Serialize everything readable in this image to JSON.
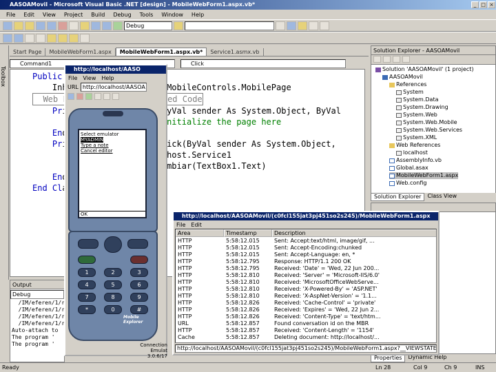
{
  "window": {
    "title": "AASOAMovil - Microsoft Visual Basic .NET [design] - MobileWebForm1.aspx.vb*"
  },
  "menu": [
    "File",
    "Edit",
    "View",
    "Project",
    "Build",
    "Debug",
    "Tools",
    "Window",
    "Help"
  ],
  "toolbar": {
    "config": "Debug",
    "find": ""
  },
  "doc_tabs": [
    {
      "label": "Start Page",
      "active": false
    },
    {
      "label": "MobileWebForm1.aspx",
      "active": false
    },
    {
      "label": "MobileWebForm1.aspx.vb*",
      "active": true
    },
    {
      "label": "Service1.asmx.vb",
      "active": false
    }
  ],
  "toolbox_label": "Toolbox",
  "editor": {
    "class_combo": "Command1",
    "method_combo": "Click",
    "lines": [
      {
        "kw": "Public Cl",
        "rest": ""
      },
      {
        "kw": "",
        "rest": "    Inherits System.Web.UI.MobileControls.MobilePage"
      },
      {
        "kw": "",
        "rest": "  Web Form Designer Generated Code"
      },
      {
        "kw": "",
        "rest": ""
      },
      {
        "kw": "    Pr",
        "rest": "ivate Sub Page_Load(ByVal sender As System.Object, ByVal"
      },
      {
        "kw": "",
        "rest": "        'Put user code to initialize the page here"
      },
      {
        "kw": "    En",
        "rest": "d Sub"
      },
      {
        "kw": "",
        "rest": ""
      },
      {
        "kw": "    Pr",
        "rest": "ivate Sub Command1_Click(ByVal sender As System.Object,"
      },
      {
        "kw": "",
        "rest": "        Dim ws As New localhost.Service1"
      },
      {
        "kw": "",
        "rest": "        Label1.Text = ws.Cambiar(TextBox1.Text)"
      },
      {
        "kw": "    En",
        "rest": "d Sub"
      },
      {
        "kw": "End Cl",
        "rest": "ass"
      }
    ]
  },
  "solution": {
    "header": "Solution Explorer - AASOAMovil",
    "items": [
      {
        "label": "Solution 'AASOAMovil' (1 project)",
        "icon": "sln",
        "indent": 0
      },
      {
        "label": "AASOAMovil",
        "icon": "proj",
        "indent": 1
      },
      {
        "label": "References",
        "icon": "fld",
        "indent": 2
      },
      {
        "label": "System",
        "icon": "ref",
        "indent": 3
      },
      {
        "label": "System.Data",
        "icon": "ref",
        "indent": 3
      },
      {
        "label": "System.Drawing",
        "icon": "ref",
        "indent": 3
      },
      {
        "label": "System.Web",
        "icon": "ref",
        "indent": 3
      },
      {
        "label": "System.Web.Mobile",
        "icon": "ref",
        "indent": 3
      },
      {
        "label": "System.Web.Services",
        "icon": "ref",
        "indent": 3
      },
      {
        "label": "System.XML",
        "icon": "ref",
        "indent": 3
      },
      {
        "label": "Web References",
        "icon": "fld",
        "indent": 2
      },
      {
        "label": "localhost",
        "icon": "ref",
        "indent": 3
      },
      {
        "label": "AssemblyInfo.vb",
        "icon": "file",
        "indent": 2
      },
      {
        "label": "Global.asax",
        "icon": "file",
        "indent": 2
      },
      {
        "label": "MobileWebForm1.aspx",
        "icon": "file",
        "indent": 2
      },
      {
        "label": "Web.config",
        "icon": "file",
        "indent": 2
      }
    ],
    "tab_solution": "Solution Explorer",
    "tab_class": "Class View"
  },
  "properties": {
    "tab_properties": "Properties",
    "tab_help": "Dynamic Help"
  },
  "output": {
    "header": "Output",
    "combo": "Debug",
    "lines": [
      "  /IM/eferen/1/r",
      "  /IM/eferen/1/r",
      "  /IM/eferen/1/r",
      "  /IM/eferen/1/r",
      "Auto-attach to",
      "The program '",
      "The program '"
    ]
  },
  "emulator": {
    "title": "http://localhost/AASO",
    "menu": [
      "File",
      "View",
      "Help"
    ],
    "url_label": "URL",
    "url": "http://localhost/AASOA",
    "screen_lines": [
      "Select emulator",
      "MYADMIN",
      "Type a note",
      "Cancel editor"
    ],
    "softkey": "OK",
    "brand": "Mobile Explorer",
    "caption": "Connection Emulat",
    "caption2": "3.0.6/17",
    "keys": [
      "1",
      "2",
      "3",
      "4",
      "5",
      "6",
      "7",
      "8",
      "9",
      "*",
      "0",
      "#"
    ]
  },
  "trace": {
    "title": "http://localhost/AASOAMovil/(c0fcl155jat3pj451so2s245)/MobileWebForm1.aspx",
    "menu": [
      "File",
      "Edit"
    ],
    "columns": [
      "Area",
      "Timestamp",
      "Description"
    ],
    "rows": [
      [
        "HTTP",
        "5:58:12.015",
        "Sent: Accept:text/html, image/gif, ..."
      ],
      [
        "HTTP",
        "5:58:12.015",
        "Sent: Accept-Encoding:chunked"
      ],
      [
        "HTTP",
        "5:58:12.015",
        "Sent: Accept-Language: en, *"
      ],
      [
        "HTTP",
        "5:58:12.795",
        "Response: HTTP/1.1 200 OK"
      ],
      [
        "HTTP",
        "5:58:12.795",
        "Received: 'Date' = 'Wed, 22 Jun 200..."
      ],
      [
        "HTTP",
        "5:58:12.810",
        "Received: 'Server' = 'Microsoft-IIS/6.0'"
      ],
      [
        "HTTP",
        "5:58:12.810",
        "Received: 'MicrosoftOfficeWebServe..."
      ],
      [
        "HTTP",
        "5:58:12.810",
        "Received: 'X-Powered-By' = 'ASP.NET'"
      ],
      [
        "HTTP",
        "5:58:12.810",
        "Received: 'X-AspNet-Version' = '1.1..."
      ],
      [
        "HTTP",
        "5:58:12.826",
        "Received: 'Cache-Control' = 'private'"
      ],
      [
        "HTTP",
        "5:58:12.826",
        "Received: 'Expires' = 'Wed, 22 Jun 2..."
      ],
      [
        "HTTP",
        "5:58:12.826",
        "Received: 'Content-Type' = 'text/htm..."
      ],
      [
        "URL",
        "5:58:12.857",
        "Found conversation id on the MBR"
      ],
      [
        "HTTP",
        "5:58:12.857",
        "Received: 'Content-Length' = '1154'"
      ],
      [
        "Cache",
        "5:58:12.857",
        "Deleting document: http://localhost/..."
      ]
    ],
    "status": "http://localhost/AASOAMovil/(c0fcl155jat3pj451so2s245)/MobileWebForm1.aspx?__VIEWSTATE=aDxMX47X"
  },
  "status": {
    "left": "Ready",
    "ln": "Ln 28",
    "col": "Col 9",
    "ch": "Ch 9",
    "ins": "INS"
  }
}
